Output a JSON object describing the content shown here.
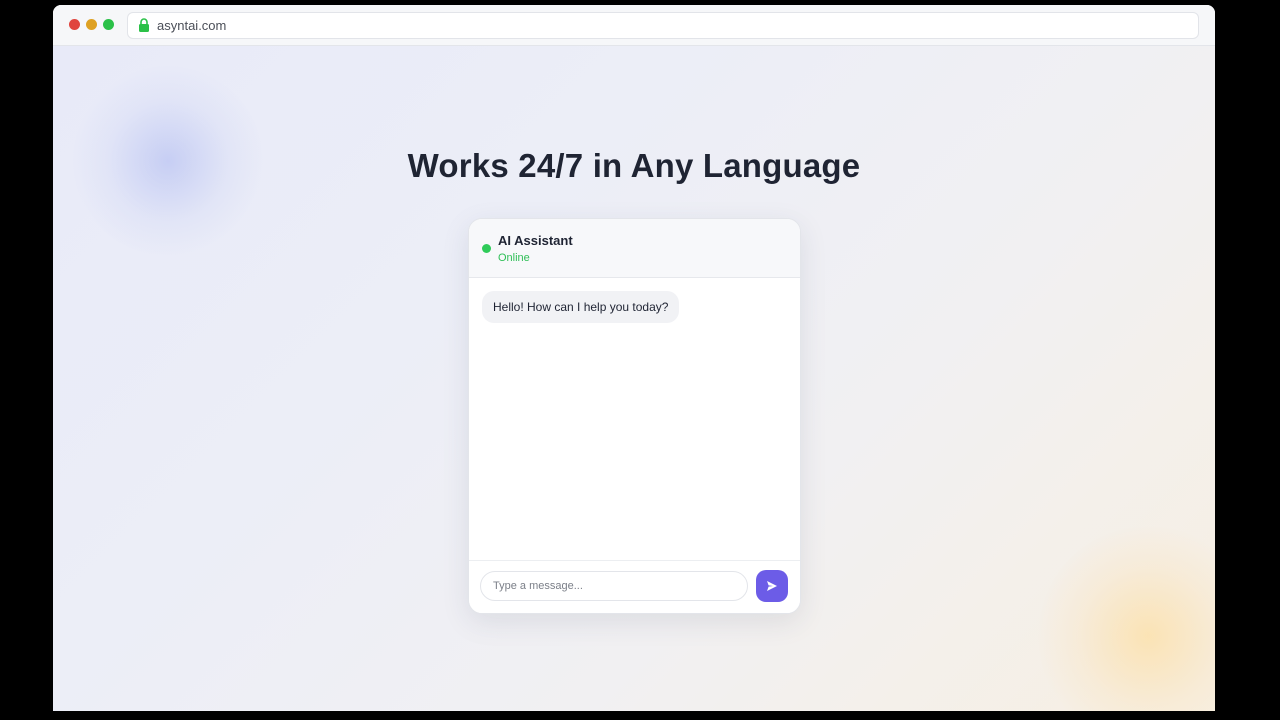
{
  "browser": {
    "url": "asyntai.com",
    "icons": {
      "secure": "lock-icon"
    },
    "controls": {
      "close_color": "#e0443e",
      "minimize_color": "#dea123",
      "maximize_color": "#2bc148"
    }
  },
  "page": {
    "headline": "Works 24/7 in Any Language"
  },
  "chat": {
    "assistant_name": "AI Assistant",
    "status": "Online",
    "status_color": "#2fcb59",
    "messages": [
      {
        "from": "assistant",
        "text": "Hello! How can I help you today?"
      }
    ],
    "input": {
      "placeholder": "Type a message...",
      "value": ""
    },
    "send_icon": "send-icon",
    "accent_color": "#6c5ce7"
  }
}
